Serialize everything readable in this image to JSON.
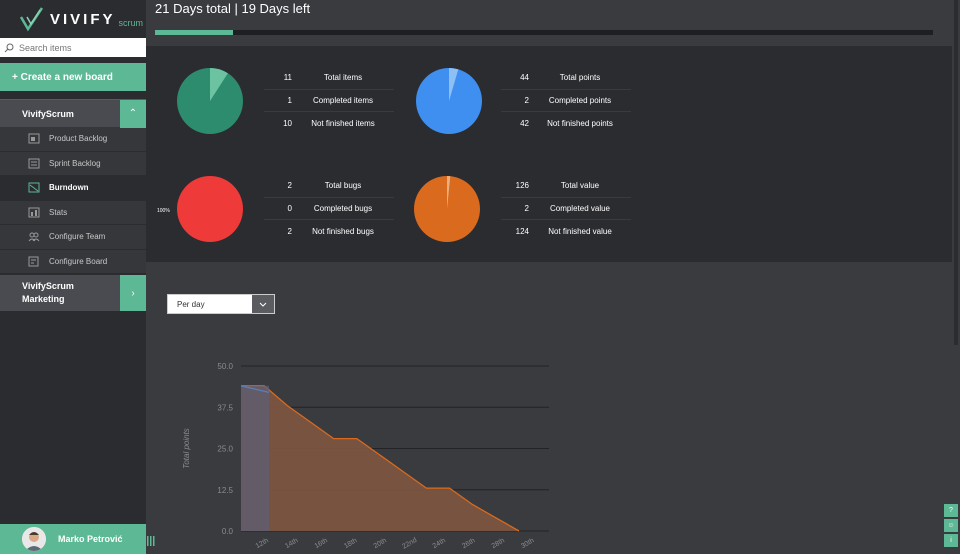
{
  "brand": {
    "name": "VIVIFY",
    "suffix": "scrum"
  },
  "search": {
    "placeholder": "Search items"
  },
  "sidebar": {
    "create_label": "+ Create a new board",
    "boards": [
      {
        "name": "VivifyScrum",
        "items": [
          {
            "label": "Product Backlog",
            "icon": "backlog-icon"
          },
          {
            "label": "Sprint Backlog",
            "icon": "sprint-icon"
          },
          {
            "label": "Burndown",
            "icon": "burndown-icon",
            "active": true
          },
          {
            "label": "Stats",
            "icon": "stats-icon"
          },
          {
            "label": "Configure Team",
            "icon": "team-icon"
          },
          {
            "label": "Configure Board",
            "icon": "board-config-icon"
          }
        ]
      },
      {
        "name_line1": "VivifyScrum",
        "name_line2": "Marketing"
      }
    ],
    "user": {
      "name": "Marko Petrović"
    }
  },
  "header": {
    "title": "21 Days total | 19 Days left",
    "progress": 0.1
  },
  "stats": {
    "items": {
      "total": "11",
      "total_label": "Total items",
      "completed": "1",
      "completed_label": "Completed items",
      "not_finished": "10",
      "not_finished_label": "Not finished items",
      "color": "#2e8c6e",
      "slice_color": "#6cc3a2"
    },
    "points": {
      "total": "44",
      "total_label": "Total points",
      "completed": "2",
      "completed_label": "Completed points",
      "not_finished": "42",
      "not_finished_label": "Not finished points",
      "color": "#3e8ff0",
      "slice_color": "#8ec0f6"
    },
    "bugs": {
      "total": "2",
      "total_label": "Total bugs",
      "completed": "0",
      "completed_label": "Completed bugs",
      "not_finished": "2",
      "not_finished_label": "Not finished bugs",
      "color": "#ef3a3a",
      "pct": "100%"
    },
    "value": {
      "total": "126",
      "total_label": "Total value",
      "completed": "2",
      "completed_label": "Completed value",
      "not_finished": "124",
      "not_finished_label": "Not finished value",
      "color": "#d96a1e",
      "slice_color": "#eab080"
    }
  },
  "filter": {
    "selected": "Per day"
  },
  "chart_data": {
    "type": "area",
    "ylabel": "Total points",
    "ylim": [
      0,
      50
    ],
    "yticks": [
      "0.0",
      "12.5",
      "25.0",
      "37.5",
      "50.0"
    ],
    "x": [
      "12th",
      "14th",
      "16th",
      "18th",
      "20th",
      "22nd",
      "24th",
      "26th",
      "28th",
      "30th"
    ],
    "series": [
      {
        "values": [
          44,
          44,
          38,
          33,
          28,
          28,
          23,
          18,
          13,
          13,
          8,
          4,
          0
        ],
        "color": "#d96a1e"
      }
    ],
    "completed_series": {
      "values": [
        44,
        42
      ],
      "color": "#5a7fb8"
    }
  },
  "colors": {
    "accent": "#5cb895",
    "sidebar": "#2b2c30",
    "panel": "#2b2c30"
  }
}
